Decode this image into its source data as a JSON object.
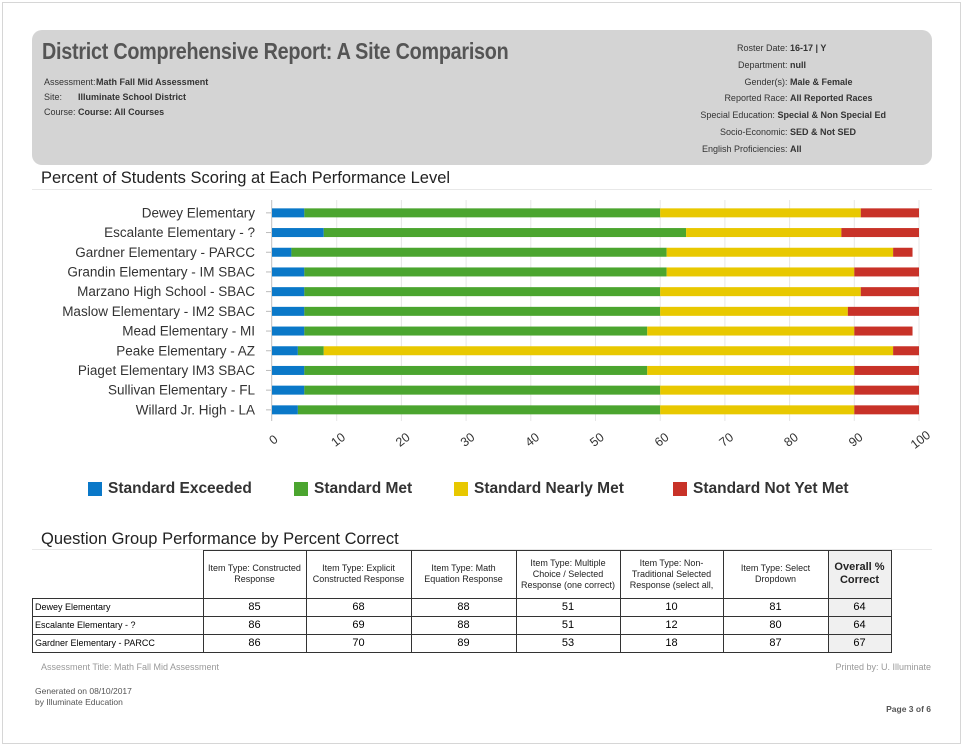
{
  "header": {
    "title": "District Comprehensive Report: A Site Comparison",
    "left_meta": [
      {
        "label": "Assessment:",
        "value": "Math Fall Mid Assessment"
      },
      {
        "label": "Site:",
        "value": "Illuminate School District"
      },
      {
        "label": "Course:",
        "value": "Course: All Courses"
      }
    ],
    "right_meta": [
      {
        "label": "Roster Date:",
        "value": "16-17 | Y"
      },
      {
        "label": "Department:",
        "value": "null"
      },
      {
        "label": "Gender(s):",
        "value": "Male & Female"
      },
      {
        "label": "Reported Race:",
        "value": "All Reported Races"
      },
      {
        "label": "Special Education:",
        "value": "Special & Non Special Ed"
      },
      {
        "label": "Socio-Economic:",
        "value": "SED & Not SED"
      },
      {
        "label": "English Proficiencies:",
        "value": "All"
      }
    ]
  },
  "performance_section": {
    "title": "Percent of Students Scoring at Each Performance Level"
  },
  "chart_data": {
    "type": "bar",
    "orientation": "horizontal",
    "stacked": true,
    "categories": [
      "Dewey Elementary",
      "Escalante Elementary - ?",
      "Gardner Elementary - PARCC",
      "Grandin Elementary - IM SBAC",
      "Marzano High School - SBAC",
      "Maslow Elementary - IM2 SBAC",
      "Mead Elementary - MI",
      "Peake Elementary - AZ",
      "Piaget Elementary IM3 SBAC",
      "Sullivan Elementary - FL",
      "Willard Jr. High - LA"
    ],
    "series": [
      {
        "name": "Standard Exceeded",
        "color": "#0a78c8",
        "values": [
          5,
          8,
          3,
          5,
          5,
          5,
          5,
          4,
          5,
          5,
          4
        ]
      },
      {
        "name": "Standard Met",
        "color": "#4ba52f",
        "values": [
          55,
          56,
          58,
          56,
          55,
          55,
          53,
          4,
          53,
          55,
          56
        ]
      },
      {
        "name": "Standard Nearly Met",
        "color": "#e8c800",
        "values": [
          31,
          24,
          35,
          29,
          31,
          29,
          32,
          88,
          32,
          30,
          30
        ]
      },
      {
        "name": "Standard Not Yet Met",
        "color": "#c83228",
        "values": [
          9,
          12,
          3,
          10,
          9,
          11,
          9,
          4,
          10,
          10,
          10
        ]
      }
    ],
    "xlim": [
      0,
      100
    ],
    "x_ticks": [
      "0",
      "10",
      "20",
      "30",
      "40",
      "50",
      "60",
      "70",
      "80",
      "90",
      "100"
    ],
    "grid": true,
    "legend_position": "bottom"
  },
  "question_section": {
    "title": "Question Group Performance by Percent Correct",
    "columns": [
      "Item Type: Constructed Response",
      "Item Type: Explicit Constructed Response",
      "Item Type: Math Equation Response",
      "Item Type: Multiple Choice / Selected Response (one correct)",
      "Item Type: Non-Traditional Selected Response (select all,",
      "Item Type: Select Dropdown",
      "Overall % Correct"
    ],
    "rows": [
      {
        "site": "Dewey Elementary",
        "values": [
          "85",
          "68",
          "88",
          "51",
          "10",
          "81",
          "64"
        ]
      },
      {
        "site": "Escalante Elementary - ?",
        "values": [
          "86",
          "69",
          "88",
          "51",
          "12",
          "80",
          "64"
        ]
      },
      {
        "site": "Gardner Elementary - PARCC",
        "values": [
          "86",
          "70",
          "89",
          "53",
          "18",
          "87",
          "67"
        ]
      }
    ]
  },
  "footer": {
    "assessment_title": "Assessment Title: Math Fall Mid Assessment",
    "printed_by": "Printed by: U. Illuminate",
    "generated_on": "Generated on 08/10/2017",
    "generated_by": "by Illuminate Education",
    "page": "Page 3 of 6"
  }
}
